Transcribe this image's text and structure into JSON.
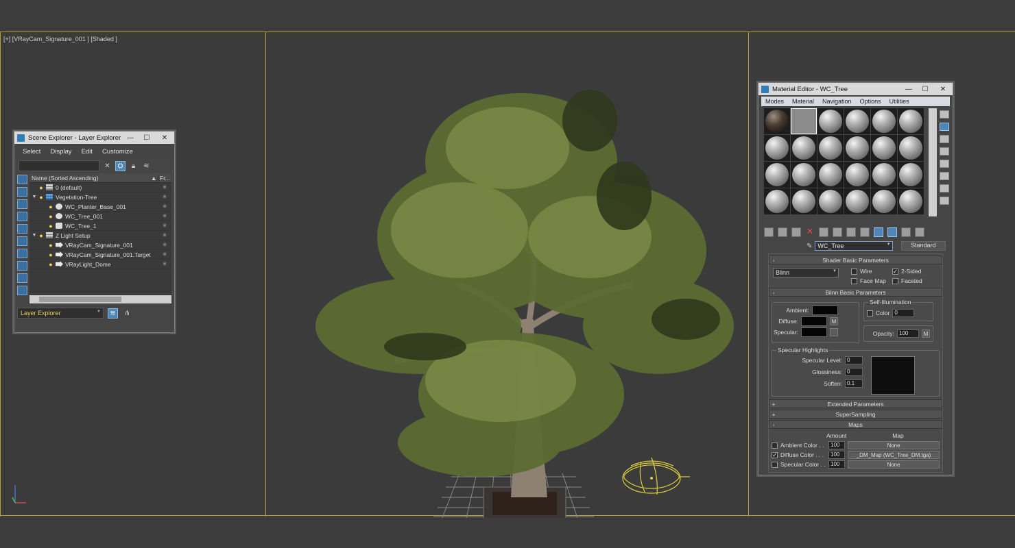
{
  "viewport": {
    "label": "[+] [VRayCam_Signature_001 ] [Shaded ]",
    "border_color": "#b6a039"
  },
  "scene_explorer": {
    "title": "Scene Explorer - Layer Explorer",
    "menu": [
      "Select",
      "Display",
      "Edit",
      "Customize"
    ],
    "column_name": "Name (Sorted Ascending)",
    "column_freeze": "Fr...",
    "rows": [
      {
        "label": "0 (default)"
      },
      {
        "label": "Vegetation-Tree"
      },
      {
        "label": "WC_Planter_Base_001"
      },
      {
        "label": "WC_Tree_001"
      },
      {
        "label": "WC_Tree_1"
      },
      {
        "label": "Z Light Setup"
      },
      {
        "label": "VRayCam_Signature_001"
      },
      {
        "label": "VRayCam_Signature_001.Target"
      },
      {
        "label": "VRayLight_Dome"
      }
    ],
    "footer_select": "Layer Explorer"
  },
  "material_editor": {
    "title": "Material Editor - WC_Tree",
    "menu": [
      "Modes",
      "Material",
      "Navigation",
      "Options",
      "Utilities"
    ],
    "material_name": "WC_Tree",
    "material_type": "Standard",
    "shader_rollout": "Shader Basic Parameters",
    "shader": "Blinn",
    "wire": "Wire",
    "two_sided": "2-Sided",
    "face_map": "Face Map",
    "faceted": "Faceted",
    "blinn_rollout": "Blinn Basic Parameters",
    "self_illum": "Self-Illumination",
    "color_label": "Color",
    "self_illum_value": "0",
    "ambient": "Ambient:",
    "diffuse": "Diffuse:",
    "specular": "Specular:",
    "m": "M",
    "opacity_label": "Opacity:",
    "opacity_value": "100",
    "spec_highlights": "Specular Highlights",
    "spec_level_label": "Specular Level:",
    "spec_level_value": "0",
    "glossiness_label": "Glossiness:",
    "glossiness_value": "0",
    "soften_label": "Soften:",
    "soften_value": "0.1",
    "extended_rollout": "Extended Parameters",
    "supersampling_rollout": "SuperSampling",
    "maps_rollout": "Maps",
    "amount_header": "Amount",
    "map_header": "Map",
    "maps": [
      {
        "label": "Ambient Color . .",
        "amount": "100",
        "map": "None",
        "checked": false
      },
      {
        "label": "Diffuse Color . . .",
        "amount": "100",
        "map": "_DM_Map (WC_Tree_DM.tga)",
        "checked": true
      },
      {
        "label": "Specular Color . .",
        "amount": "100",
        "map": "None",
        "checked": false
      }
    ]
  },
  "colors": {
    "accent_blue": "#4f86b8",
    "layer_text_yellow": "#e0cf55",
    "bulb_yellow": "#f3d45a"
  }
}
